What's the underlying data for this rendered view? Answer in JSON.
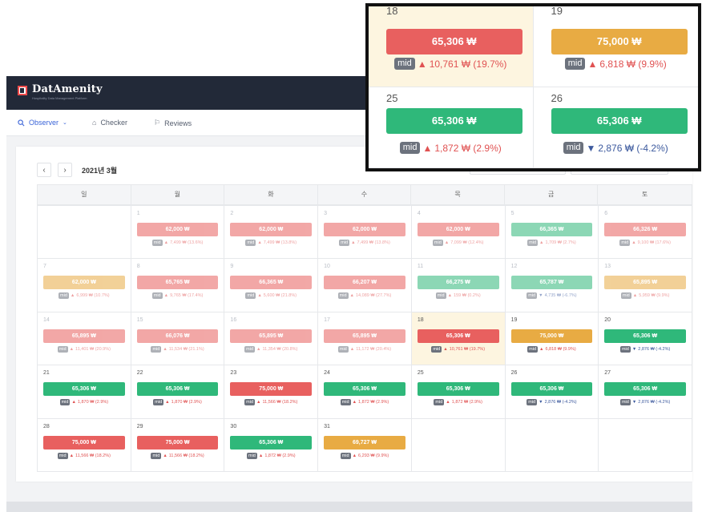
{
  "app": {
    "brand": "DatAmenity",
    "brand_sub": "Hospitality Data Management Platform",
    "nav": [
      {
        "label": "Observer",
        "icon": "search-icon",
        "chevron": "chevron-down-icon",
        "active": true
      },
      {
        "label": "Checker",
        "icon": "bank-icon",
        "active": false
      },
      {
        "label": "Reviews",
        "icon": "flag-icon",
        "active": false
      }
    ]
  },
  "calendar": {
    "month": "2021년 3월",
    "prev_label": "‹",
    "next_label": "›",
    "weekdays": [
      "일",
      "월",
      "화",
      "수",
      "목",
      "금",
      "토"
    ],
    "mid_label": "mid",
    "colors": {
      "red": "#e8605f",
      "green": "#2fb87a",
      "orange": "#e8ab43"
    },
    "days": [
      {
        "day": "1",
        "price": "62,000 ₩",
        "color": "red",
        "dir": "up",
        "delta": "7,499 ₩ (13.6%)"
      },
      {
        "day": "2",
        "price": "62,000 ₩",
        "color": "red",
        "dir": "up",
        "delta": "7,499 ₩ (13.8%)"
      },
      {
        "day": "3",
        "price": "62,000 ₩",
        "color": "red",
        "dir": "up",
        "delta": "7,499 ₩ (13.8%)"
      },
      {
        "day": "4",
        "price": "62,000 ₩",
        "color": "red",
        "dir": "up",
        "delta": "7,099 ₩ (12.4%)"
      },
      {
        "day": "5",
        "price": "66,365 ₩",
        "color": "green",
        "dir": "up",
        "delta": "1,709 ₩ (2.7%)"
      },
      {
        "day": "6",
        "price": "66,326 ₩",
        "color": "red",
        "dir": "up",
        "delta": "9,100 ₩ (17.6%)"
      },
      {
        "day": "7",
        "price": "62,000 ₩",
        "color": "orange",
        "dir": "up",
        "delta": "6,999 ₩ (10.7%)"
      },
      {
        "day": "8",
        "price": "65,765 ₩",
        "color": "red",
        "dir": "up",
        "delta": "9,765 ₩ (17.4%)"
      },
      {
        "day": "9",
        "price": "66,365 ₩",
        "color": "red",
        "dir": "up",
        "delta": "5,600 ₩ (21.8%)"
      },
      {
        "day": "10",
        "price": "66,207 ₩",
        "color": "red",
        "dir": "up",
        "delta": "14,089 ₩ (27.7%)"
      },
      {
        "day": "11",
        "price": "66,275 ₩",
        "color": "green",
        "dir": "up",
        "delta": "159 ₩ (0.2%)"
      },
      {
        "day": "12",
        "price": "65,787 ₩",
        "color": "green",
        "dir": "down",
        "delta": "4,735 ₩ (-6.7%)"
      },
      {
        "day": "13",
        "price": "65,895 ₩",
        "color": "orange",
        "dir": "up",
        "delta": "5,959 ₩ (9.9%)"
      },
      {
        "day": "14",
        "price": "65,895 ₩",
        "color": "red",
        "dir": "up",
        "delta": "11,401 ₩ (20.9%)"
      },
      {
        "day": "15",
        "price": "66,076 ₩",
        "color": "red",
        "dir": "up",
        "delta": "11,534 ₩ (21.1%)"
      },
      {
        "day": "16",
        "price": "65,895 ₩",
        "color": "red",
        "dir": "up",
        "delta": "11,354 ₩ (20.8%)"
      },
      {
        "day": "17",
        "price": "65,895 ₩",
        "color": "red",
        "dir": "up",
        "delta": "11,172 ₩ (20.4%)"
      },
      {
        "day": "18",
        "price": "65,306 ₩",
        "color": "red",
        "dir": "up",
        "delta": "10,761 ₩ (19.7%)",
        "highlight": true,
        "full": true
      },
      {
        "day": "19",
        "price": "75,000 ₩",
        "color": "orange",
        "dir": "up",
        "delta": "6,818 ₩ (9.9%)",
        "full": true
      },
      {
        "day": "20",
        "price": "65,306 ₩",
        "color": "green",
        "dir": "down",
        "delta": "2,876 ₩ (-4.2%)",
        "full": true
      },
      {
        "day": "21",
        "price": "65,306 ₩",
        "color": "green",
        "dir": "up",
        "delta": "1,870 ₩ (2.9%)",
        "full": true
      },
      {
        "day": "22",
        "price": "65,306 ₩",
        "color": "green",
        "dir": "up",
        "delta": "1,870 ₩ (2.9%)",
        "full": true
      },
      {
        "day": "23",
        "price": "75,000 ₩",
        "color": "red",
        "dir": "up",
        "delta": "11,566 ₩ (18.2%)",
        "full": true
      },
      {
        "day": "24",
        "price": "65,306 ₩",
        "color": "green",
        "dir": "up",
        "delta": "1,872 ₩ (2.9%)",
        "full": true
      },
      {
        "day": "25",
        "price": "65,306 ₩",
        "color": "green",
        "dir": "up",
        "delta": "1,872 ₩ (2.9%)",
        "full": true
      },
      {
        "day": "26",
        "price": "65,306 ₩",
        "color": "green",
        "dir": "down",
        "delta": "2,876 ₩ (-4.2%)",
        "full": true
      },
      {
        "day": "27",
        "price": "65,306 ₩",
        "color": "green",
        "dir": "down",
        "delta": "2,876 ₩ (-4.2%)",
        "full": true
      },
      {
        "day": "28",
        "price": "75,000 ₩",
        "color": "red",
        "dir": "up",
        "delta": "11,566 ₩ (18.2%)",
        "full": true
      },
      {
        "day": "29",
        "price": "75,000 ₩",
        "color": "red",
        "dir": "up",
        "delta": "11,566 ₩ (18.2%)",
        "full": true
      },
      {
        "day": "30",
        "price": "65,306 ₩",
        "color": "green",
        "dir": "up",
        "delta": "1,872 ₩ (2.9%)",
        "full": true
      },
      {
        "day": "31",
        "price": "69,727 ₩",
        "color": "orange",
        "dir": "up",
        "delta": "6,293 ₩ (9.9%)",
        "full": true
      }
    ]
  },
  "zoom": {
    "cells": [
      {
        "day": "18",
        "price": "65,306 ₩",
        "color": "red",
        "dir": "up",
        "delta": "10,761 ₩ (19.7%)",
        "highlight": true
      },
      {
        "day": "19",
        "price": "75,000 ₩",
        "color": "orange",
        "dir": "up",
        "delta": "6,818 ₩ (9.9%)"
      },
      {
        "day": "25",
        "price": "65,306 ₩",
        "color": "green",
        "dir": "up",
        "delta": "1,872 ₩ (2.9%)"
      },
      {
        "day": "26",
        "price": "65,306 ₩",
        "color": "green",
        "dir": "down",
        "delta": "2,876 ₩ (-4.2%)"
      }
    ]
  }
}
